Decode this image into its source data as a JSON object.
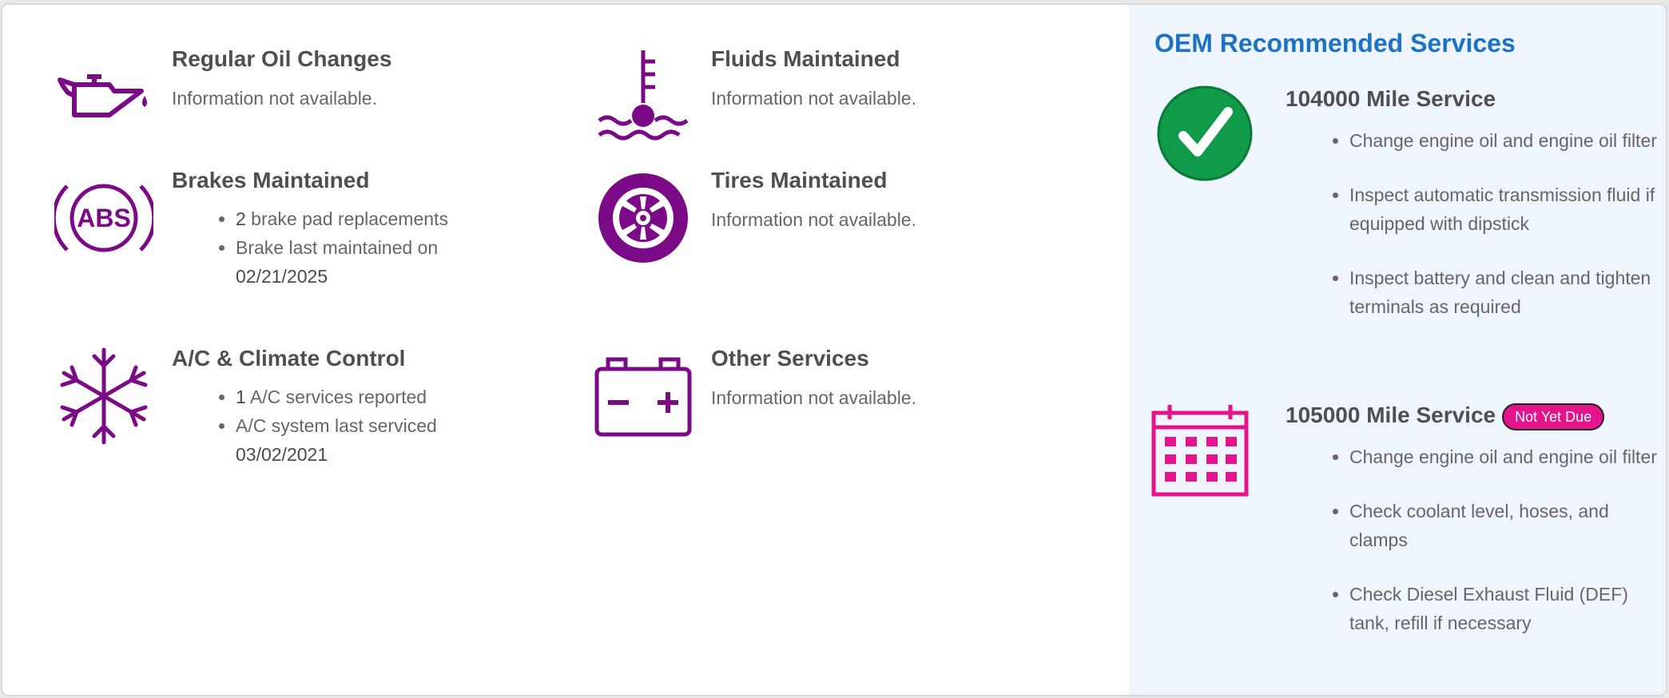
{
  "services": {
    "oil": {
      "title": "Regular Oil Changes",
      "text": "Information not available."
    },
    "fluids": {
      "title": "Fluids Maintained",
      "text": "Information not available."
    },
    "brakes": {
      "title": "Brakes Maintained",
      "items": [
        {
          "count": "2",
          "text": " brake pad replacements"
        },
        {
          "prefix": "Brake last maintained on ",
          "date": "02/21/2025"
        }
      ]
    },
    "tires": {
      "title": "Tires Maintained",
      "text": "Information not available."
    },
    "ac": {
      "title": "A/C & Climate Control",
      "items": [
        {
          "count": "1",
          "text": " A/C services reported"
        },
        {
          "prefix": "A/C system last serviced ",
          "date": "03/02/2021"
        }
      ]
    },
    "other": {
      "title": "Other Services",
      "text": "Information not available."
    }
  },
  "oem": {
    "title": "OEM Recommended Services",
    "services": [
      {
        "title": "104000 Mile Service",
        "items": [
          "Change engine oil and engine oil filter",
          "Inspect automatic transmission fluid if equipped with dipstick",
          "Inspect battery and clean and tighten terminals as required"
        ]
      },
      {
        "title": "105000 Mile Service",
        "badge": "Not Yet Due",
        "items": [
          "Change engine oil and engine oil filter",
          "Check coolant level, hoses, and clamps",
          "Check Diesel Exhaust Fluid (DEF) tank, refill if necessary"
        ]
      }
    ]
  },
  "colors": {
    "icon": "#7b0a86",
    "oem_title": "#1d72c4",
    "check": "#0f9b49",
    "calendar": "#e4148c"
  }
}
